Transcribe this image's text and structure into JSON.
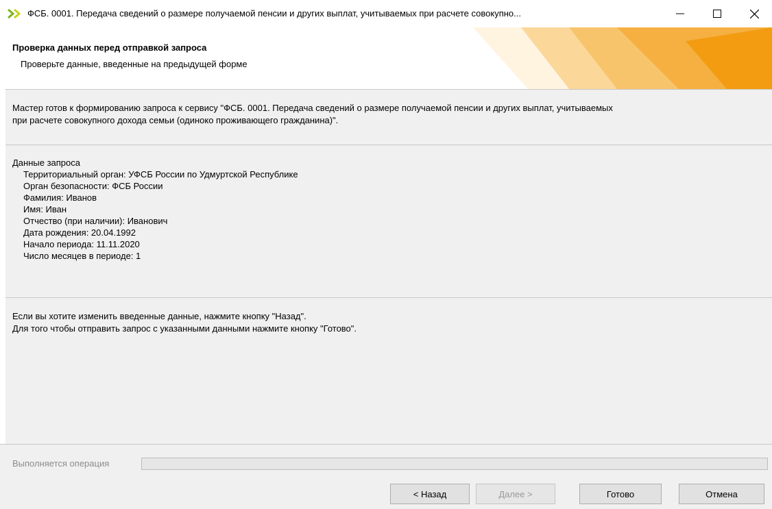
{
  "window": {
    "title": "ФСБ. 0001. Передача сведений о размере получаемой пенсии и других выплат, учитываемых при расчете совокупно...",
    "icon": "double-chevron-right-icon"
  },
  "header": {
    "title": "Проверка данных перед отправкой запроса",
    "subtitle": "Проверьте данные, введенные на предыдущей форме"
  },
  "intro": {
    "line1": "Мастер готов к формированию запроса к сервису \"ФСБ. 0001. Передача сведений о размере получаемой пенсии и других выплат, учитываемых",
    "line2": "при расчете совокупного дохода семьи (одиноко проживающего гражданина)\"."
  },
  "request_data": {
    "heading": "Данные запроса",
    "lines": [
      "Территориальный орган: УФСБ России по Удмуртской Республике",
      "Орган безопасности: ФСБ России",
      "Фамилия: Иванов",
      "Имя: Иван",
      "Отчество (при наличии): Иванович",
      "Дата рождения: 20.04.1992",
      "Начало периода: 11.11.2020",
      "Число месяцев в периоде: 1"
    ]
  },
  "hint": {
    "line1": "Если вы хотите изменить введенные данные, нажмите кнопку \"Назад\".",
    "line2": "Для того чтобы отправить запрос с указанными данными нажмите кнопку \"Готово\"."
  },
  "status": {
    "operation_label": "Выполняется операция",
    "progress": 0
  },
  "buttons": {
    "back": "< Назад",
    "next": "Далее >",
    "done": "Готово",
    "cancel": "Отмена"
  },
  "colors": {
    "accent_orange": "#f39c12",
    "icon_green": "#6aaa1e"
  }
}
